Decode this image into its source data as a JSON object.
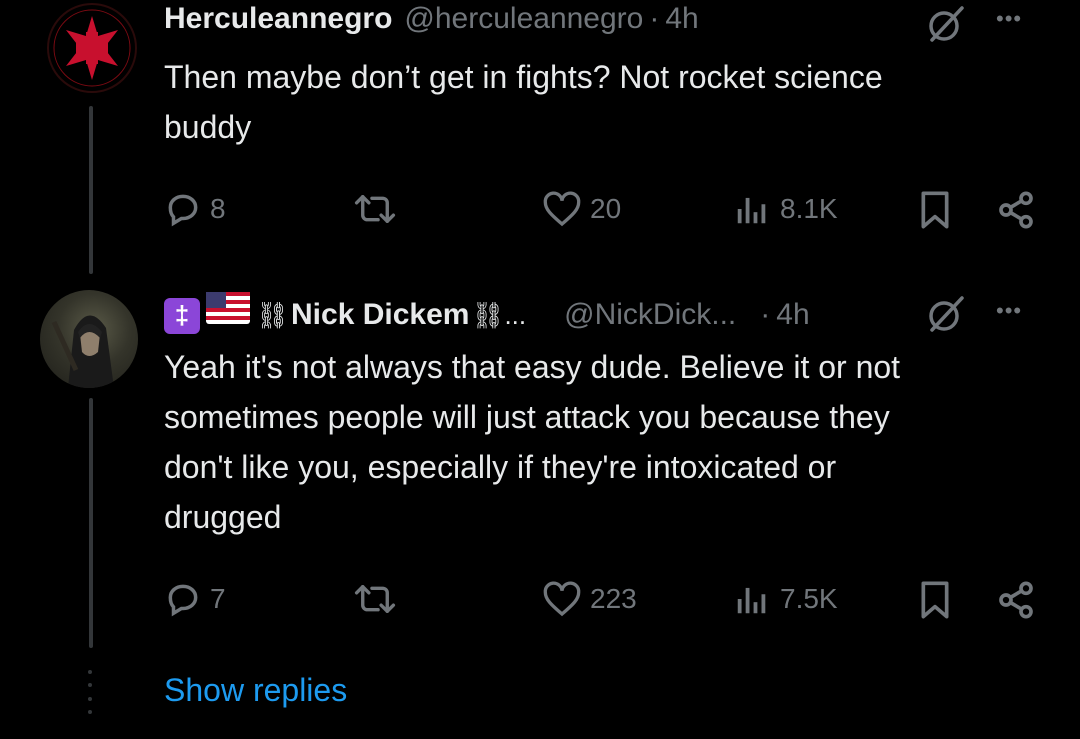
{
  "tweet1": {
    "display_name": "Herculeannegro",
    "handle": "@herculeannegro",
    "separator": "·",
    "time": "4h",
    "text_line1": "Then maybe don’t get in fights? Not rocket science",
    "text_line2": "buddy",
    "actions": {
      "replies": "8",
      "reposts": "",
      "likes": "20",
      "views": "8.1K"
    },
    "avatar_icon": "templar-cross-icon"
  },
  "tweet2": {
    "display_name": "Nick Dickem",
    "name_prefix_badge": "‡",
    "ornament_left": "⛓",
    "ornament_right": "⛓...",
    "handle": "@NickDick...",
    "separator": "·",
    "time": "4h",
    "text_lines": [
      "Yeah it's not always that easy dude. Believe it or not",
      "sometimes people will just attack you because they",
      "don't like you, especially if they're intoxicated or",
      "drugged"
    ],
    "actions": {
      "replies": "7",
      "reposts": "",
      "likes": "223",
      "views": "7.5K"
    }
  },
  "show_replies_label": "Show replies",
  "more_label": "•••",
  "colors": {
    "background": "#000000",
    "text_primary": "#e7e9ea",
    "text_secondary": "#71767b",
    "link_blue": "#1d9bf0",
    "thread_line": "#333639",
    "badge_purple": "#8b46d8",
    "cross_red": "#c8102e"
  }
}
